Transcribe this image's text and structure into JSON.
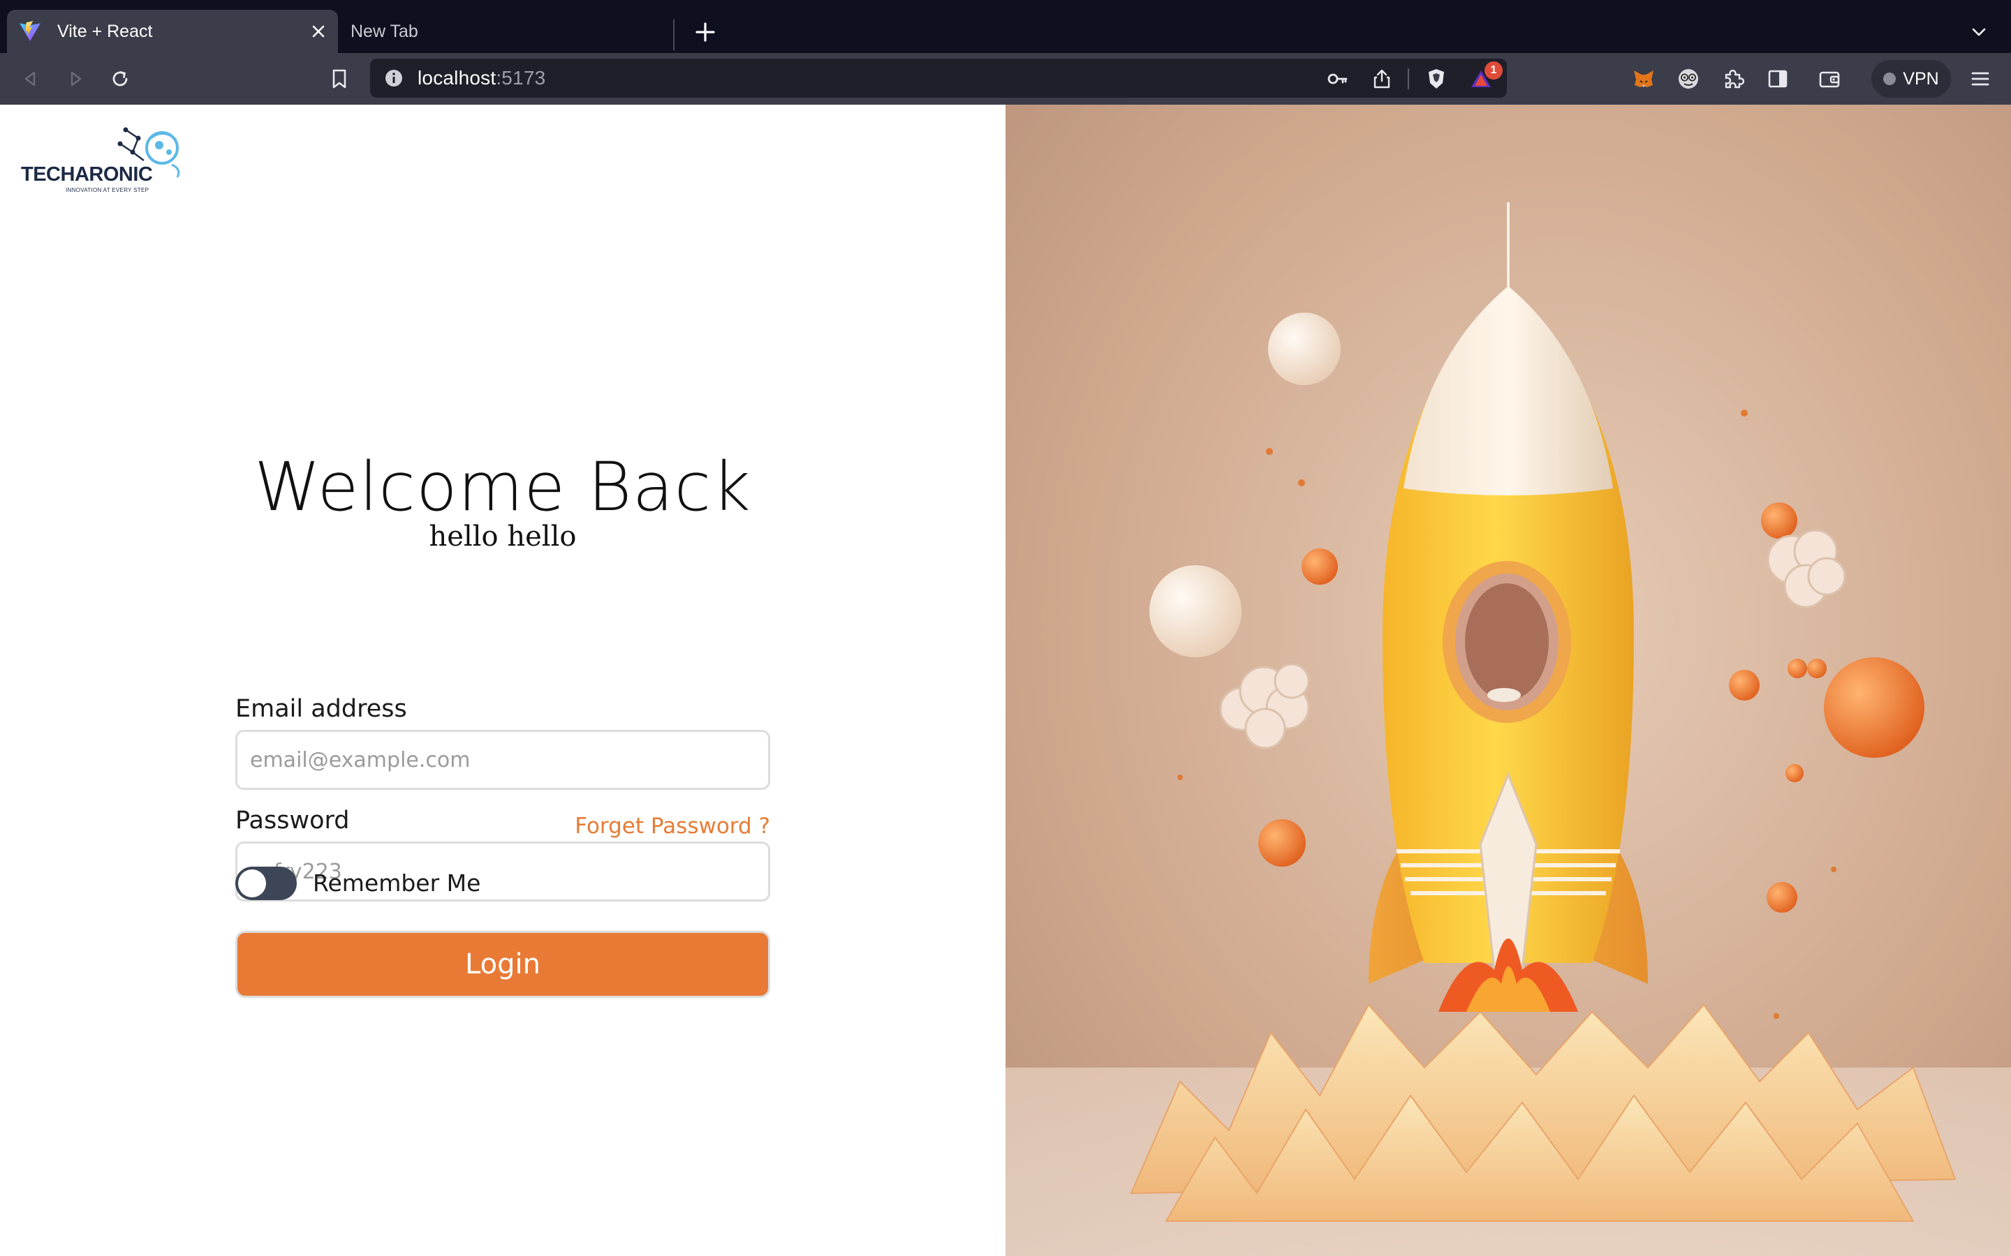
{
  "browser": {
    "tabs": [
      {
        "title": "Vite + React",
        "active": true
      },
      {
        "title": "New Tab",
        "active": false
      }
    ],
    "url": {
      "host": "localhost",
      "port": ":5173"
    },
    "notification_count": "1",
    "vpn_label": "VPN"
  },
  "logo": {
    "name": "TECHARONIC",
    "tagline": "INNOVATION AT EVERY STEP"
  },
  "login": {
    "heading": "Welcome Back",
    "subtitle": "hello hello",
    "email_label": "Email address",
    "email_placeholder": "email@example.com",
    "password_label": "Password",
    "password_placeholder": "sofry223",
    "forgot_link": "Forget Password ?",
    "remember_label": "Remember Me",
    "remember_on": false,
    "login_button": "Login"
  },
  "colors": {
    "accent": "#e97a35",
    "toggle_track": "#3c4656",
    "chrome_dark": "#0e1020",
    "toolbar": "#3b3d4a"
  },
  "illustration": {
    "subject": "rocket-launch"
  }
}
